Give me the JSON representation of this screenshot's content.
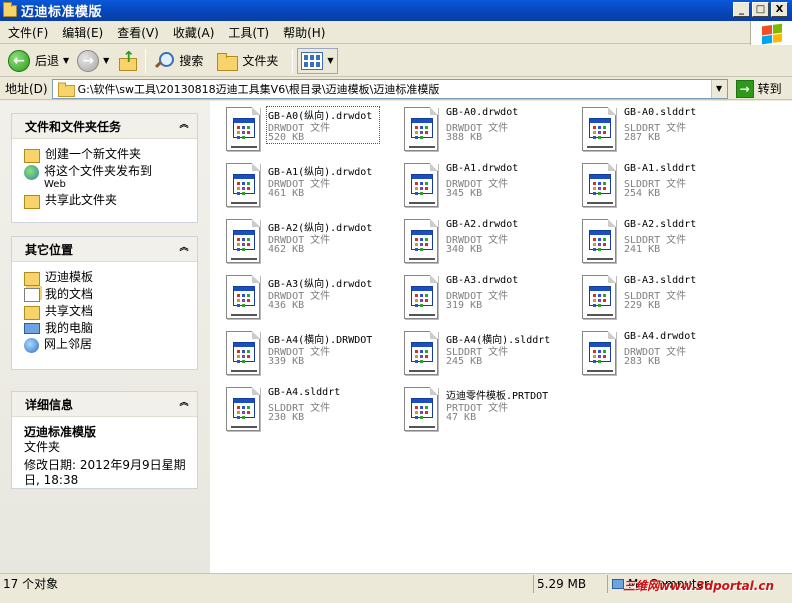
{
  "window": {
    "title": "迈迪标准模版",
    "min": "_",
    "max": "□",
    "close": "X"
  },
  "menu": [
    "文件(F)",
    "编辑(E)",
    "查看(V)",
    "收藏(A)",
    "工具(T)",
    "帮助(H)"
  ],
  "toolbar": {
    "back": "后退",
    "search": "搜索",
    "folders": "文件夹"
  },
  "address": {
    "label": "地址(D)",
    "path": "G:\\软件\\sw工具\\20130818迈迪工具集V6\\根目录\\迈迪模板\\迈迪标准模版",
    "go": "转到"
  },
  "tasks_panel": {
    "title": "文件和文件夹任务",
    "items": [
      {
        "label": "创建一个新文件夹",
        "sub": ""
      },
      {
        "label": "将这个文件夹发布到",
        "sub": "Web"
      },
      {
        "label": "共享此文件夹",
        "sub": ""
      }
    ]
  },
  "places_panel": {
    "title": "其它位置",
    "items": [
      "迈迪模板",
      "我的文档",
      "共享文档",
      "我的电脑",
      "网上邻居"
    ]
  },
  "details_panel": {
    "title": "详细信息",
    "name": "迈迪标准模版",
    "type": "文件夹",
    "modified_line1": "修改日期: 2012年9月9日星期",
    "modified_line2": "日, 18:38"
  },
  "files": [
    {
      "name": "GB-A0(纵向).drwdot",
      "type": "DRWDOT 文件",
      "size": "520 KB",
      "selected": true
    },
    {
      "name": "GB-A0.drwdot",
      "type": "DRWDOT 文件",
      "size": "388 KB"
    },
    {
      "name": "GB-A0.slddrt",
      "type": "SLDDRT 文件",
      "size": "287 KB"
    },
    {
      "name": "GB-A1(纵向).drwdot",
      "type": "DRWDOT 文件",
      "size": "461 KB"
    },
    {
      "name": "GB-A1.drwdot",
      "type": "DRWDOT 文件",
      "size": "345 KB"
    },
    {
      "name": "GB-A1.slddrt",
      "type": "SLDDRT 文件",
      "size": "254 KB"
    },
    {
      "name": "GB-A2(纵向).drwdot",
      "type": "DRWDOT 文件",
      "size": "462 KB"
    },
    {
      "name": "GB-A2.drwdot",
      "type": "DRWDOT 文件",
      "size": "340 KB"
    },
    {
      "name": "GB-A2.slddrt",
      "type": "SLDDRT 文件",
      "size": "241 KB"
    },
    {
      "name": "GB-A3(纵向).drwdot",
      "type": "DRWDOT 文件",
      "size": "436 KB"
    },
    {
      "name": "GB-A3.drwdot",
      "type": "DRWDOT 文件",
      "size": "319 KB"
    },
    {
      "name": "GB-A3.slddrt",
      "type": "SLDDRT 文件",
      "size": "229 KB"
    },
    {
      "name": "GB-A4(横向).DRWDOT",
      "type": "DRWDOT 文件",
      "size": "339 KB"
    },
    {
      "name": "GB-A4(横向).slddrt",
      "type": "SLDDRT 文件",
      "size": "245 KB"
    },
    {
      "name": "GB-A4.drwdot",
      "type": "DRWDOT 文件",
      "size": "283 KB"
    },
    {
      "name": "GB-A4.slddrt",
      "type": "SLDDRT 文件",
      "size": "230 KB"
    },
    {
      "name": "迈迪零件模板.PRTDOT",
      "type": "PRTDOT 文件",
      "size": "47 KB"
    }
  ],
  "status": {
    "count": "17 个对象",
    "size": "5.29 MB",
    "location": "My Computer",
    "watermark": "三维网www.3dportal.cn"
  },
  "colors": {
    "titlebar": "#0544b6",
    "panel_bg": "#ffffff",
    "folder": "#f6d36b"
  }
}
